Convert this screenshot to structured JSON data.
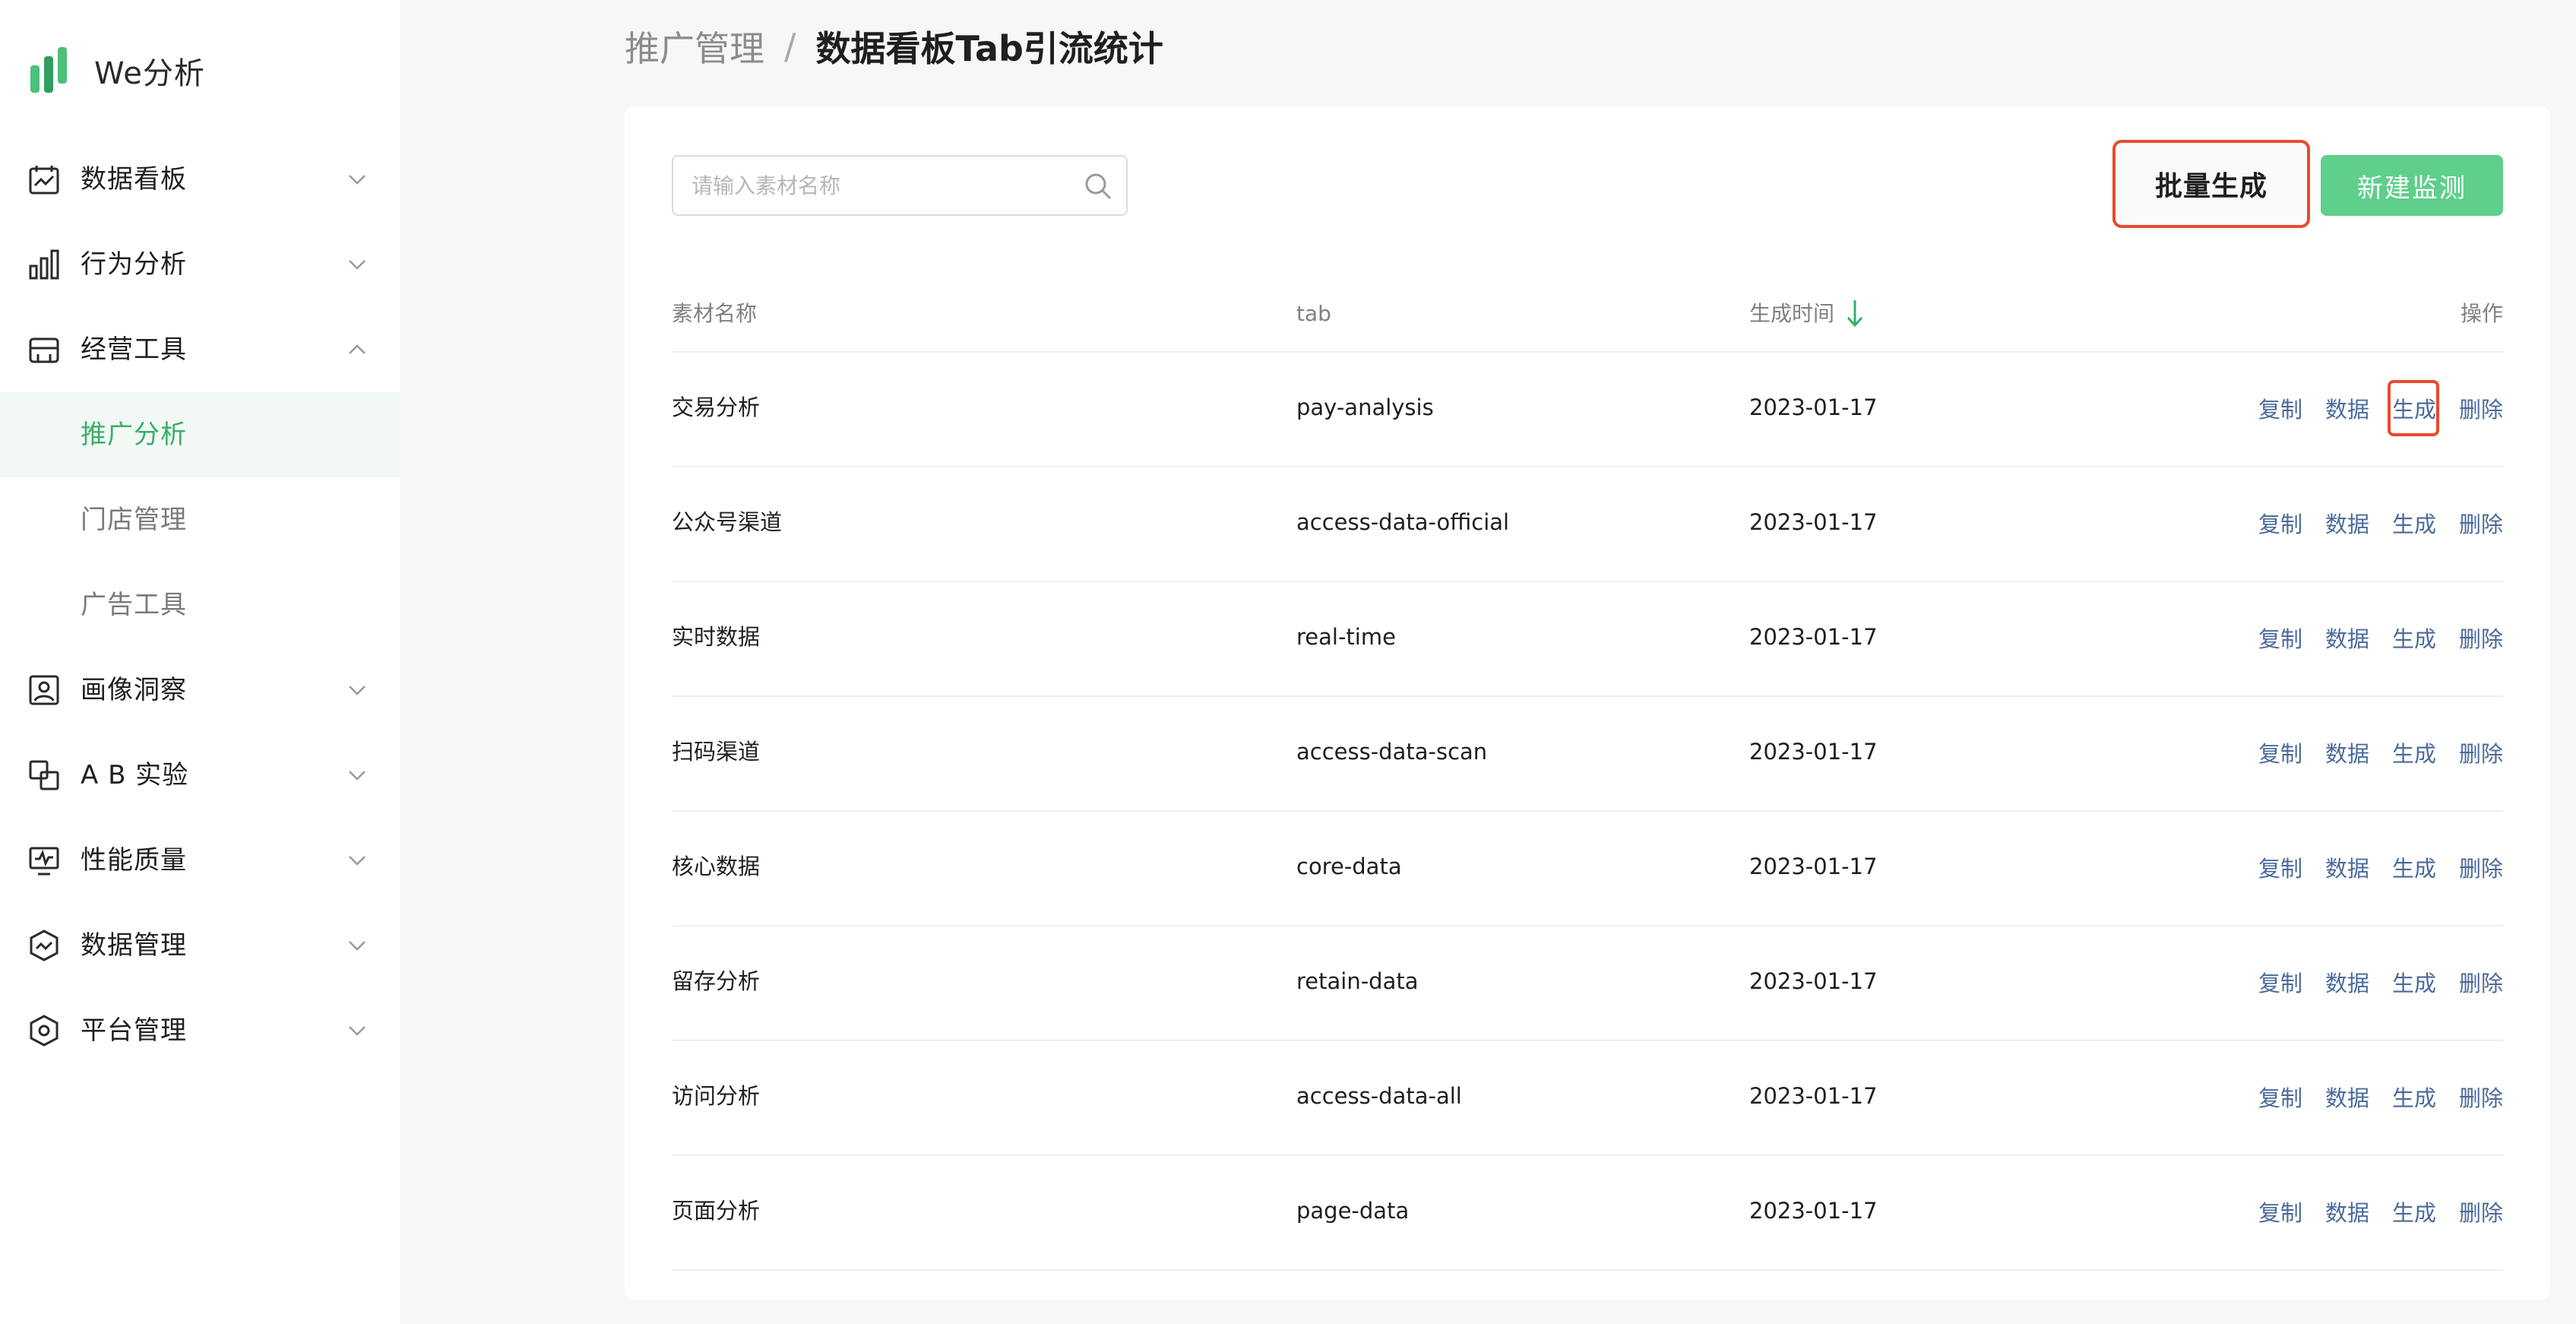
{
  "brand": {
    "name": "We分析"
  },
  "sidebar": {
    "items": [
      {
        "label": "数据看板",
        "icon": "dashboard-icon",
        "expanded": false
      },
      {
        "label": "行为分析",
        "icon": "bar-chart-icon",
        "expanded": false
      },
      {
        "label": "经营工具",
        "icon": "store-icon",
        "expanded": true
      },
      {
        "label": "画像洞察",
        "icon": "portrait-icon",
        "expanded": false
      },
      {
        "label": "A B 实验",
        "icon": "ab-test-icon",
        "expanded": false
      },
      {
        "label": "性能质量",
        "icon": "monitor-icon",
        "expanded": false
      },
      {
        "label": "数据管理",
        "icon": "data-shield-icon",
        "expanded": false
      },
      {
        "label": "平台管理",
        "icon": "hexagon-gear-icon",
        "expanded": false
      }
    ],
    "subitems": [
      {
        "label": "推广分析",
        "active": true
      },
      {
        "label": "门店管理",
        "active": false
      },
      {
        "label": "广告工具",
        "active": false
      }
    ]
  },
  "breadcrumb": {
    "root": "推广管理",
    "separator": "/",
    "current": "数据看板Tab引流统计"
  },
  "search": {
    "placeholder": "请输入素材名称",
    "value": ""
  },
  "toolbar": {
    "batch_label": "批量生成",
    "new_label": "新建监测"
  },
  "table": {
    "columns": {
      "name": "素材名称",
      "tab": "tab",
      "time": "生成时间",
      "ops": "操作"
    },
    "sort": {
      "column": "生成时间",
      "direction": "desc"
    },
    "ops_labels": {
      "copy": "复制",
      "data": "数据",
      "generate": "生成",
      "delete": "删除"
    },
    "rows": [
      {
        "name": "交易分析",
        "tab": "pay-analysis",
        "time": "2023-01-17"
      },
      {
        "name": "公众号渠道",
        "tab": "access-data-official",
        "time": "2023-01-17"
      },
      {
        "name": "实时数据",
        "tab": "real-time",
        "time": "2023-01-17"
      },
      {
        "name": "扫码渠道",
        "tab": "access-data-scan",
        "time": "2023-01-17"
      },
      {
        "name": "核心数据",
        "tab": "core-data",
        "time": "2023-01-17"
      },
      {
        "name": "留存分析",
        "tab": "retain-data",
        "time": "2023-01-17"
      },
      {
        "name": "访问分析",
        "tab": "access-data-all",
        "time": "2023-01-17"
      },
      {
        "name": "页面分析",
        "tab": "page-data",
        "time": "2023-01-17"
      }
    ]
  },
  "colors": {
    "accent": "#3aad6a",
    "button_green": "#5fcf8b",
    "link": "#4a6a9b",
    "highlight": "#e84a2e"
  }
}
